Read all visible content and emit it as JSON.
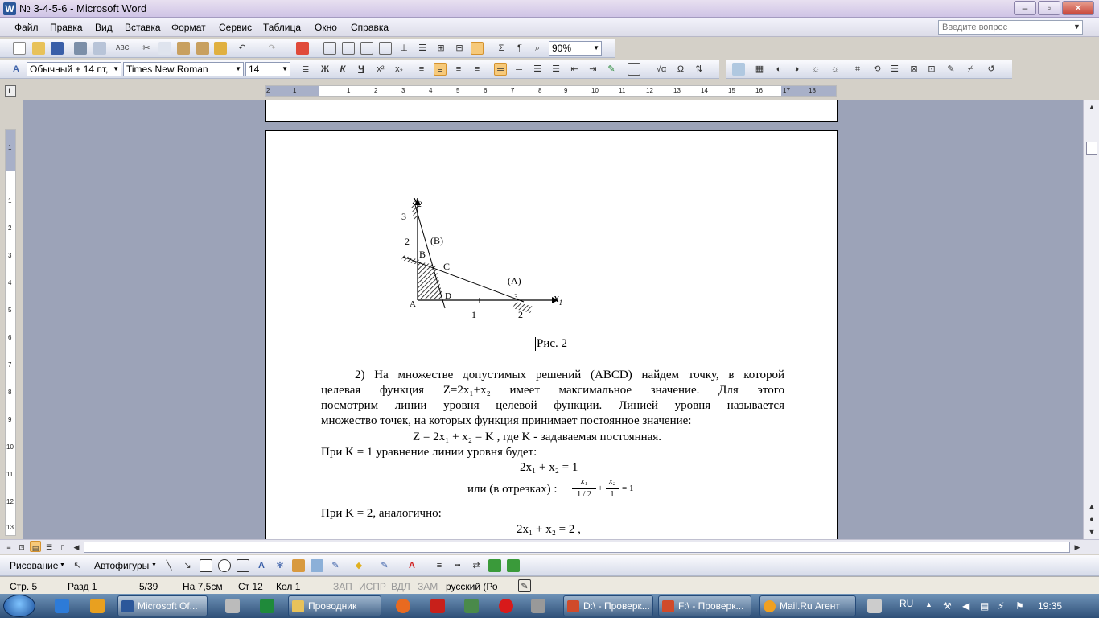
{
  "window": {
    "title": "№ 3-4-5-6 - Microsoft Word",
    "app_icon": "W"
  },
  "window_controls": {
    "minimize": "–",
    "maximize": "▫",
    "close": "✕"
  },
  "menu": [
    "Файл",
    "Правка",
    "Вид",
    "Вставка",
    "Формат",
    "Сервис",
    "Таблица",
    "Окно",
    "Справка"
  ],
  "ask": {
    "placeholder": "Введите вопрос"
  },
  "toolbar_standard": {
    "zoom": "90%"
  },
  "toolbar_format": {
    "style": "Обычный + 14 пт,",
    "font": "Times New Roman",
    "size": "14",
    "bold": "Ж",
    "italic": "К",
    "underline": "Ч"
  },
  "ruler": {
    "marks": [
      "2",
      "1",
      "1",
      "2",
      "3",
      "4",
      "5",
      "6",
      "7",
      "8",
      "9",
      "10",
      "11",
      "12",
      "13",
      "14",
      "15",
      "16",
      "17",
      "18"
    ]
  },
  "ruler_v": {
    "marks": [
      "1",
      "1",
      "2",
      "3",
      "4",
      "5",
      "6",
      "7",
      "8",
      "9",
      "10",
      "11",
      "12",
      "13"
    ]
  },
  "figure": {
    "x_axis": "x",
    "x_sub": "1",
    "y_axis": "x",
    "y_sub": "2",
    "y_ticks": [
      "3",
      "2"
    ],
    "x_ticks": [
      "1",
      "2"
    ],
    "labels": {
      "A": "A",
      "B": "B",
      "C": "C",
      "D": "D",
      "lineA": "(A)",
      "lineB": "(B)",
      "three": "3"
    },
    "caption": "Рис. 2"
  },
  "body": {
    "para1_l1": "2) На множестве допустимых решений (ABCD) найдем точку, в которой",
    "para1_l2": "целевая функция Z=2x₁+x₂ имеет максимальное значение. Для этого",
    "para1_l3": "посмотрим линии уровня целевой функции. Линией уровня называется",
    "para1_l4": "множество точек, на которых функция принимает постоянное значение:",
    "formula1": "Z = 2x₁ + x₂ = K , где K - задаваемая постоянная.",
    "k1": "При K = 1 уравнение линии уровня будет:",
    "eq1": "2x₁ + x₂ = 1",
    "seg_prefix": "или (в отрезках) :",
    "frac1_num": "x₁",
    "frac1_den": "1 / 2",
    "plus": "+",
    "frac2_num": "x₂",
    "frac2_den": "1",
    "eq_rhs": "= 1",
    "k2": "При K = 2, аналогично:",
    "eq2": "2x₁ + x₂ = 2 ,"
  },
  "drawbar": {
    "draw": "Рисование",
    "autoshapes": "Автофигуры"
  },
  "status": {
    "page": "Стр. 5",
    "section": "Разд 1",
    "pages": "5/39",
    "at": "На 7,5см",
    "line": "Ст 12",
    "col": "Кол 1",
    "rec": "ЗАП",
    "trk": "ИСПР",
    "ext": "ВДЛ",
    "ovr": "ЗАМ",
    "lang": "русский (Ро"
  },
  "taskbar": {
    "tasks": [
      "Microsoft Of...",
      "Проводник",
      "D:\\ - Проверк...",
      "F:\\ - Проверк...",
      "Mail.Ru Агент"
    ],
    "lang": "RU",
    "time": "19:35"
  }
}
